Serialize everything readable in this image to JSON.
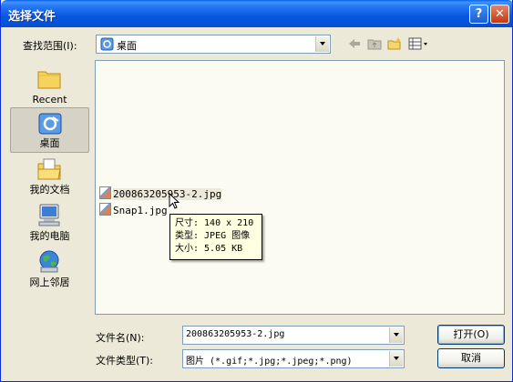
{
  "window": {
    "title": "选择文件",
    "help_glyph": "?",
    "close_glyph": "✕"
  },
  "lookin": {
    "label": "查找范围(I):",
    "value": "桌面"
  },
  "places": [
    {
      "label": "Recent",
      "icon": "recent-folder-icon"
    },
    {
      "label": "桌面",
      "icon": "desktop-icon"
    },
    {
      "label": "我的文档",
      "icon": "my-documents-icon"
    },
    {
      "label": "我的电脑",
      "icon": "my-computer-icon"
    },
    {
      "label": "网上邻居",
      "icon": "network-places-icon"
    }
  ],
  "files": [
    {
      "name": "200863205953-2.jpg"
    },
    {
      "name": "Snap1.jpg"
    }
  ],
  "tooltip": {
    "size": "尺寸: 140 x 210",
    "type": "类型: JPEG 图像",
    "filesize": "大小: 5.05 KB"
  },
  "filename": {
    "label": "文件名(N):",
    "value": "200863205953-2.jpg"
  },
  "filetype": {
    "label": "文件类型(T):",
    "value": "图片 (*.gif;*.jpg;*.jpeg;*.png)"
  },
  "buttons": {
    "open": "打开(O)",
    "cancel": "取消"
  }
}
